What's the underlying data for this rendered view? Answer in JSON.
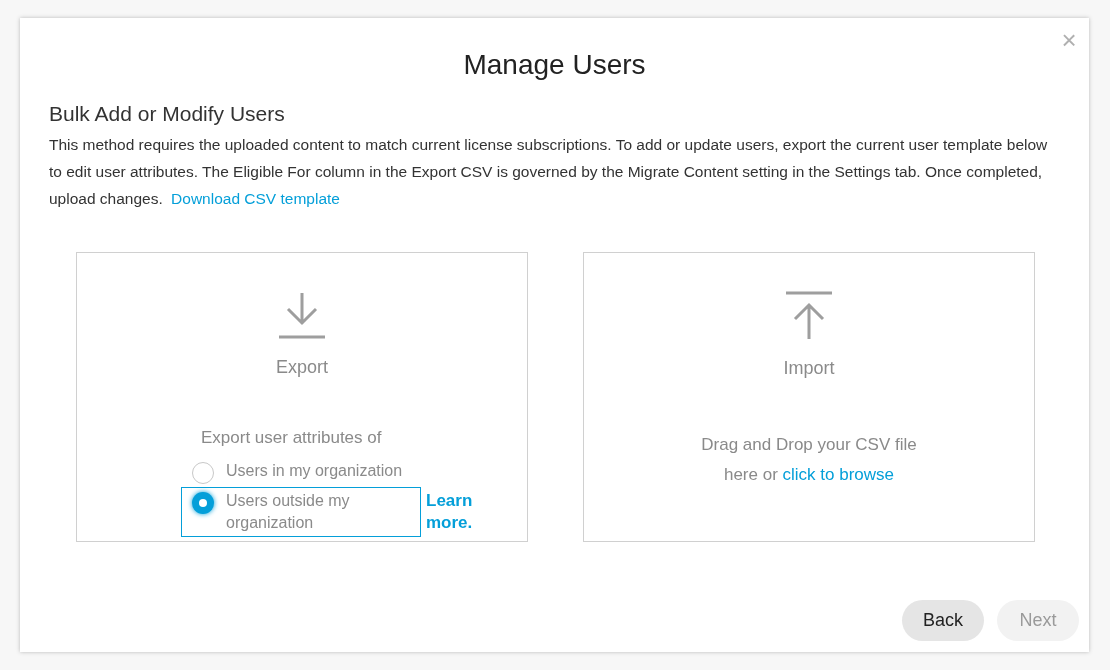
{
  "dialog": {
    "title": "Manage Users",
    "close": "×"
  },
  "section": {
    "heading": "Bulk Add or Modify Users",
    "description": "This method requires the uploaded content to match current license subscriptions. To add or update users, export the current user template below to edit user attributes. The Eligible For column in the Export CSV is governed by the Migrate Content setting in the Settings tab. Once completed, upload changes.",
    "link": "Download CSV template"
  },
  "export": {
    "label": "Export",
    "prompt": "Export user attributes of",
    "options": [
      {
        "label": "Users in my organization",
        "selected": false
      },
      {
        "label": "Users outside my organization",
        "selected": true
      }
    ],
    "learn_more": "Learn more."
  },
  "import": {
    "label": "Import",
    "text": "Drag and Drop your CSV file here or",
    "link": "click to browse"
  },
  "buttons": [
    {
      "label": "Back",
      "disabled": false
    },
    {
      "label": "Next",
      "disabled": true
    }
  ]
}
